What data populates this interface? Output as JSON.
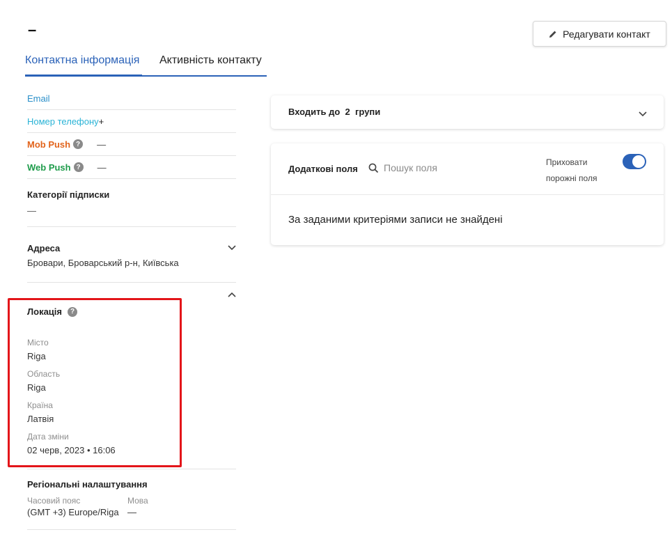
{
  "page": {
    "title": "–"
  },
  "actions": {
    "edit_label": "Редагувати контакт"
  },
  "tabs": [
    {
      "label": "Контактна інформація",
      "active": true
    },
    {
      "label": "Активність контакту",
      "active": false
    }
  ],
  "channels": {
    "email": "Email",
    "phone": "Номер телефону",
    "phone_value": "+",
    "mob_push": "Mob Push",
    "mob_push_value": "—",
    "web_push": "Web Push",
    "web_push_value": "—",
    "colors": {
      "email": "#2a8fc9",
      "phone": "#2ab3d6",
      "mob_push": "#e2641c",
      "web_push": "#1f9c4b"
    }
  },
  "subscriptions": {
    "title": "Категорії підписки",
    "value": "—"
  },
  "address": {
    "title": "Адреса",
    "value": "Бровари, Броварський р-н, Київська"
  },
  "location": {
    "title": "Локація",
    "city_label": "Місто",
    "city": "Riga",
    "region_label": "Область",
    "region": "Riga",
    "country_label": "Країна",
    "country": "Латвія",
    "changed_label": "Дата зміни",
    "changed": "02 черв, 2023 • 16:06"
  },
  "regional": {
    "title": "Регіональні налаштування",
    "tz_label": "Часовий пояс",
    "tz": "(GMT +3) Europe/Riga",
    "lang_label": "Мова",
    "lang": "—"
  },
  "groups": {
    "prefix": "Входить до",
    "count": "2",
    "suffix": "групи"
  },
  "fields": {
    "title": "Додаткові поля",
    "search_placeholder": "Пошук поля",
    "hide_empty_label": "Приховати порожні поля",
    "hide_empty_on": true,
    "empty_message": "За заданими критеріями записи не знайдені"
  },
  "accent_color": "#2b62b8",
  "highlight_color": "#e3151a"
}
